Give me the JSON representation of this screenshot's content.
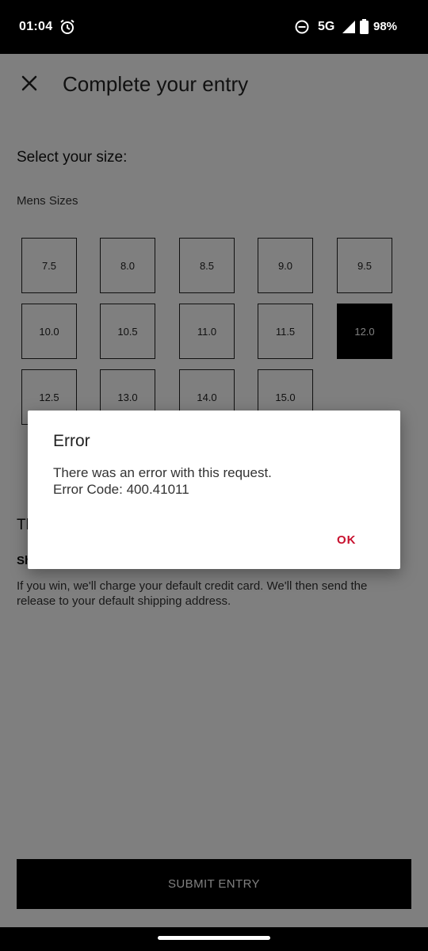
{
  "status_bar": {
    "time": "01:04",
    "network": "5G",
    "battery": "98%",
    "icons": [
      "alarm-icon",
      "do-not-disturb-icon",
      "signal-icon",
      "battery-icon"
    ]
  },
  "app_bar": {
    "title": "Complete your entry",
    "close_icon": "close-icon"
  },
  "size_section": {
    "heading": "Select your size:",
    "group_label": "Mens Sizes",
    "sizes": [
      "7.5",
      "8.0",
      "8.5",
      "9.0",
      "9.5",
      "10.0",
      "10.5",
      "11.0",
      "11.5",
      "12.0",
      "12.5",
      "13.0",
      "14.0",
      "15.0"
    ],
    "selected": "12.0"
  },
  "raffle_section": {
    "heading": "Th",
    "shipping_label": "Sh",
    "info": "If you win, we'll charge your default credit card. We'll then send the release to your default shipping address."
  },
  "submit": {
    "label": "SUBMIT ENTRY"
  },
  "dialog": {
    "title": "Error",
    "message_line1": "There was an error with this request.",
    "message_line2": "Error Code: 400.41011",
    "ok_label": "OK"
  },
  "colors": {
    "selected_bg": "#000000",
    "dialog_accent": "#c8102e",
    "scrim": "rgba(0,0,0,0.5)"
  }
}
